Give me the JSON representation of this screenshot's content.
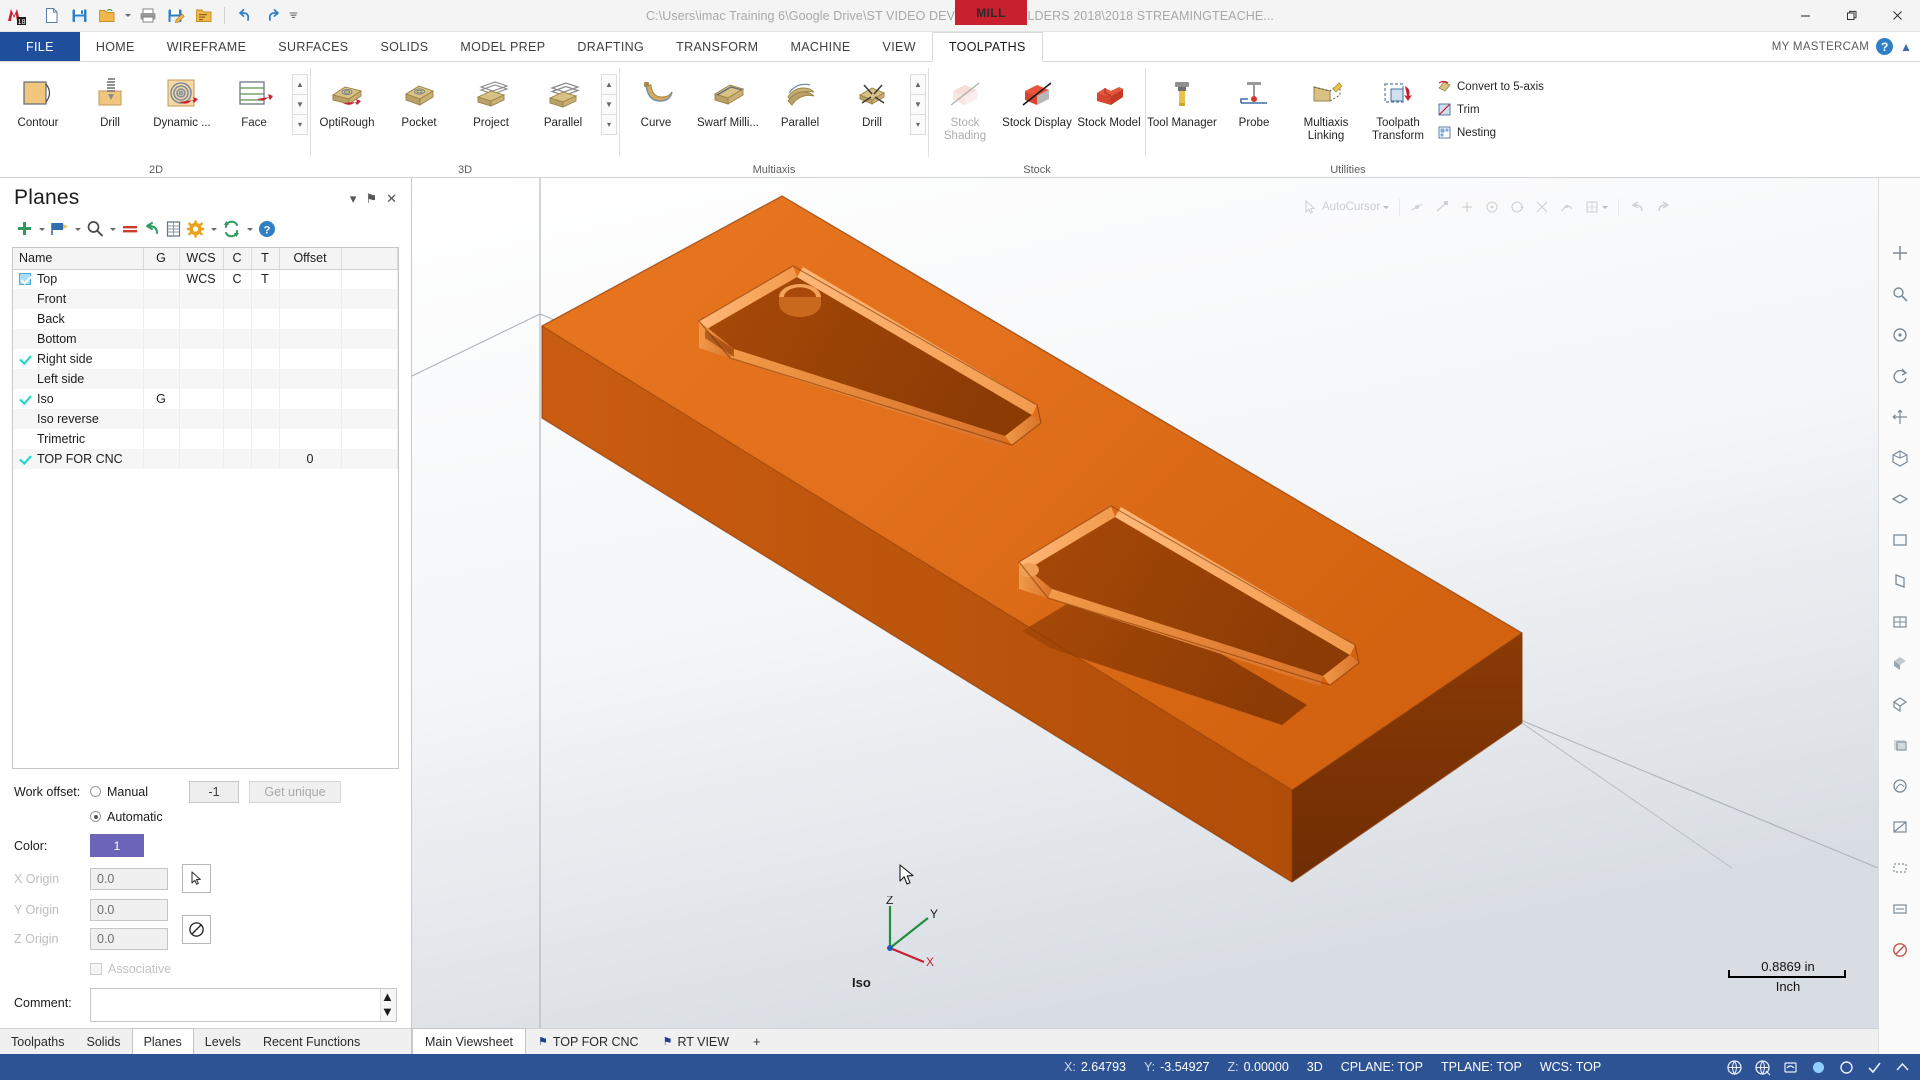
{
  "titlebar": {
    "app_logo": "mastercam-logo",
    "path": "C:\\Users\\imac Training 6\\Google Drive\\ST VIDEO DEVELOPER FOLDERS 2018\\2018 STREAMINGTEACHE...",
    "machine_badge": "MILL",
    "quick_access": [
      {
        "name": "new-file",
        "icon": "page-icon"
      },
      {
        "name": "save",
        "icon": "floppy-icon"
      },
      {
        "name": "open",
        "icon": "folder-open-icon",
        "has_caret": true
      },
      {
        "name": "print",
        "icon": "printer-icon"
      },
      {
        "name": "save-as",
        "icon": "floppy-pencil-icon"
      },
      {
        "name": "file-list",
        "icon": "folder-list-icon"
      },
      {
        "name": "undo",
        "icon": "undo-arrow-icon"
      },
      {
        "name": "redo",
        "icon": "redo-arrow-icon"
      },
      {
        "name": "customize-qat",
        "icon": "chevron-down-icon"
      }
    ],
    "window_controls": [
      "minimize",
      "restore",
      "close"
    ]
  },
  "ribbon": {
    "tabs": [
      {
        "label": "FILE",
        "kind": "file"
      },
      {
        "label": "HOME"
      },
      {
        "label": "WIREFRAME"
      },
      {
        "label": "SURFACES"
      },
      {
        "label": "SOLIDS"
      },
      {
        "label": "MODEL PREP"
      },
      {
        "label": "DRAFTING"
      },
      {
        "label": "TRANSFORM"
      },
      {
        "label": "MACHINE"
      },
      {
        "label": "VIEW"
      },
      {
        "label": "TOOLPATHS",
        "active": true
      }
    ],
    "account_label": "MY MASTERCAM",
    "help_label": "?",
    "groups": [
      {
        "label": "2D",
        "buttons": [
          {
            "label": "Contour",
            "icon": "contour-toolpath-icon"
          },
          {
            "label": "Drill",
            "icon": "drill-toolpath-icon"
          },
          {
            "label": "Dynamic ...",
            "icon": "dynamic-mill-icon"
          },
          {
            "label": "Face",
            "icon": "face-toolpath-icon"
          }
        ],
        "has_spinner": true
      },
      {
        "label": "3D",
        "buttons": [
          {
            "label": "OptiRough",
            "icon": "optirough-icon"
          },
          {
            "label": "Pocket",
            "icon": "pocket-icon"
          },
          {
            "label": "Project",
            "icon": "project-icon"
          },
          {
            "label": "Parallel",
            "icon": "parallel-icon"
          }
        ],
        "has_spinner": true
      },
      {
        "label": "Multiaxis",
        "buttons": [
          {
            "label": "Curve",
            "icon": "curve-multiaxis-icon"
          },
          {
            "label": "Swarf Milli...",
            "icon": "swarf-mill-icon"
          },
          {
            "label": "Parallel",
            "icon": "parallel-multiaxis-icon"
          },
          {
            "label": "Drill",
            "icon": "drill-multiaxis-icon"
          }
        ],
        "has_spinner": true
      },
      {
        "label": "Stock",
        "buttons": [
          {
            "label": "Stock Shading",
            "icon": "stock-shading-icon",
            "disabled": true
          },
          {
            "label": "Stock Display",
            "icon": "stock-display-icon"
          },
          {
            "label": "Stock Model",
            "icon": "stock-model-icon",
            "has_caret": true
          }
        ]
      },
      {
        "label": "Utilities",
        "buttons": [
          {
            "label": "Tool Manager",
            "icon": "tool-manager-icon"
          },
          {
            "label": "Probe",
            "icon": "probe-icon"
          },
          {
            "label": "Multiaxis Linking",
            "icon": "multiaxis-linking-icon"
          },
          {
            "label": "Toolpath Transform",
            "icon": "toolpath-transform-icon"
          }
        ],
        "small_buttons": [
          {
            "label": "Convert to 5-axis",
            "icon": "convert-5axis-icon"
          },
          {
            "label": "Trim",
            "icon": "trim-icon"
          },
          {
            "label": "Nesting",
            "icon": "nesting-icon"
          }
        ]
      }
    ]
  },
  "planes_panel": {
    "title": "Planes",
    "header_buttons": [
      {
        "name": "minimize-panel",
        "glyph": "▾"
      },
      {
        "name": "pin-panel",
        "glyph": "⚑"
      },
      {
        "name": "close-panel",
        "glyph": "✕"
      }
    ],
    "toolbar": [
      {
        "name": "create-new-plane",
        "icon": "plus-icon",
        "caret": true
      },
      {
        "name": "select-plane-flag",
        "icon": "flag-icon",
        "caret": true
      },
      {
        "name": "find-plane",
        "icon": "magnifier-icon",
        "caret": true
      },
      {
        "name": "delete-plane",
        "icon": "delete-bars-icon",
        "caret": false
      },
      {
        "name": "undo-plane",
        "icon": "undo-arrow-icon",
        "caret": false
      },
      {
        "name": "plane-properties",
        "icon": "list-panel-icon",
        "caret": false
      },
      {
        "name": "plane-settings",
        "icon": "gear-icon",
        "caret": true
      },
      {
        "name": "refresh-planes",
        "icon": "refresh-icon",
        "caret": true
      },
      {
        "name": "planes-help",
        "icon": "help-icon",
        "caret": false
      }
    ],
    "columns": [
      "Name",
      "G",
      "WCS",
      "C",
      "T",
      "Offset"
    ],
    "rows": [
      {
        "check": "box",
        "name": "Top",
        "g": "",
        "wcs": "WCS",
        "c": "C",
        "t": "T",
        "offset": ""
      },
      {
        "check": "none",
        "name": "Front",
        "g": "",
        "wcs": "",
        "c": "",
        "t": "",
        "offset": ""
      },
      {
        "check": "none",
        "name": "Back",
        "g": "",
        "wcs": "",
        "c": "",
        "t": "",
        "offset": ""
      },
      {
        "check": "none",
        "name": "Bottom",
        "g": "",
        "wcs": "",
        "c": "",
        "t": "",
        "offset": ""
      },
      {
        "check": "tick",
        "name": "Right side",
        "g": "",
        "wcs": "",
        "c": "",
        "t": "",
        "offset": ""
      },
      {
        "check": "none",
        "name": "Left side",
        "g": "",
        "wcs": "",
        "c": "",
        "t": "",
        "offset": ""
      },
      {
        "check": "tick",
        "name": "Iso",
        "g": "G",
        "wcs": "",
        "c": "",
        "t": "",
        "offset": ""
      },
      {
        "check": "none",
        "name": "Iso reverse",
        "g": "",
        "wcs": "",
        "c": "",
        "t": "",
        "offset": ""
      },
      {
        "check": "none",
        "name": "Trimetric",
        "g": "",
        "wcs": "",
        "c": "",
        "t": "",
        "offset": ""
      },
      {
        "check": "tick",
        "name": "TOP FOR CNC",
        "g": "",
        "wcs": "",
        "c": "",
        "t": "",
        "offset": "0"
      }
    ],
    "form": {
      "work_offset_label": "Work offset:",
      "manual_label": "Manual",
      "manual_selected": false,
      "automatic_label": "Automatic",
      "automatic_selected": true,
      "offset_value": "-1",
      "get_unique_label": "Get unique",
      "color_label": "Color:",
      "color_value": "1",
      "color_hex": "#6b64b8",
      "x_origin_label": "X Origin",
      "x_origin_value": "0.0",
      "y_origin_label": "Y Origin",
      "y_origin_value": "0.0",
      "z_origin_label": "Z Origin",
      "z_origin_value": "0.0",
      "pick_origin_icon": "cursor-pick-icon",
      "clear_origin_icon": "no-entry-icon",
      "associative_label": "Associative",
      "associative_checked": false,
      "comment_label": "Comment:",
      "comment_value": ""
    },
    "tabs": [
      {
        "label": "Toolpaths"
      },
      {
        "label": "Solids"
      },
      {
        "label": "Planes",
        "active": true
      },
      {
        "label": "Levels"
      },
      {
        "label": "Recent Functions"
      }
    ]
  },
  "viewport": {
    "floating_toolbar": [
      {
        "label": "AutoCursor",
        "icon": "autocursor-icon",
        "caret": true
      },
      {
        "name": "snap-midpoint",
        "icon": "midpoint-icon"
      },
      {
        "name": "snap-endpoint",
        "icon": "endpoint-icon"
      },
      {
        "name": "snap-point",
        "icon": "point-icon"
      },
      {
        "name": "snap-center",
        "icon": "center-icon"
      },
      {
        "name": "snap-quadrant",
        "icon": "quadrant-icon"
      },
      {
        "name": "snap-intersect",
        "icon": "intersect-icon"
      },
      {
        "name": "snap-nearest",
        "icon": "nearest-icon"
      },
      {
        "name": "snap-mode",
        "icon": "snap-mode-icon",
        "caret": true
      },
      {
        "name": "view-undo",
        "icon": "view-undo-icon"
      },
      {
        "name": "view-redo",
        "icon": "view-redo-icon"
      }
    ],
    "view_name": "Iso",
    "axis_labels": {
      "x": "X",
      "y": "Y",
      "z": "Z"
    },
    "scale_value": "0.8869 in",
    "scale_unit": "Inch",
    "right_rail": [
      {
        "name": "fit-view-icon"
      },
      {
        "name": "zoom-window-icon"
      },
      {
        "name": "zoom-target-icon"
      },
      {
        "name": "dynamic-rotate-icon"
      },
      {
        "name": "pan-icon"
      },
      {
        "name": "isometric-view-icon"
      },
      {
        "name": "top-view-icon"
      },
      {
        "name": "front-view-icon"
      },
      {
        "name": "right-view-icon"
      },
      {
        "name": "wireframe-shade-icon"
      },
      {
        "name": "shaded-icon"
      },
      {
        "name": "shaded-edges-icon"
      },
      {
        "name": "translucency-icon"
      },
      {
        "name": "material-icon"
      },
      {
        "name": "section-view-icon"
      },
      {
        "name": "blank-entities-icon"
      },
      {
        "name": "unblank-entities-icon"
      },
      {
        "name": "hide-icon"
      }
    ]
  },
  "viewsheets": {
    "tabs": [
      {
        "label": "Main Viewsheet",
        "flag": false,
        "active": true
      },
      {
        "label": "TOP FOR CNC",
        "flag": true,
        "active": false
      },
      {
        "label": "RT VIEW",
        "flag": true,
        "active": false
      }
    ],
    "add_label": "+"
  },
  "statusbar": {
    "coords": [
      {
        "label": "X:",
        "value": "2.64793"
      },
      {
        "label": "Y:",
        "value": "-3.54927"
      },
      {
        "label": "Z:",
        "value": "0.00000"
      }
    ],
    "mode": "3D",
    "cplane": "CPLANE: TOP",
    "tplane": "TPLANE: TOP",
    "wcs": "WCS: TOP",
    "icons": [
      {
        "name": "globe-icon"
      },
      {
        "name": "globe-wcs-icon"
      },
      {
        "name": "toolpath-display-icon"
      },
      {
        "name": "shading-toggle-icon"
      },
      {
        "name": "wireframe-toggle-icon"
      },
      {
        "name": "verify-icon"
      },
      {
        "name": "expand-icon"
      }
    ]
  }
}
